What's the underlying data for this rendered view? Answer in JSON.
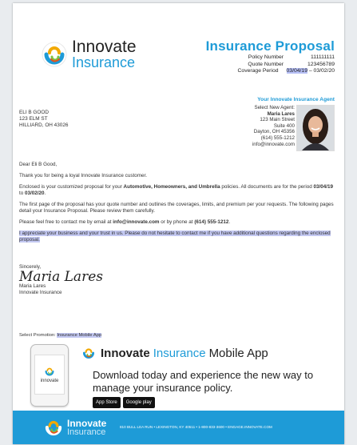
{
  "brand": {
    "word1": "Innovate",
    "word2": "Insurance"
  },
  "header": {
    "title": "Insurance Proposal",
    "policy_label": "Policy Number",
    "policy_value": "111111111",
    "quote_label": "Quote Number",
    "quote_value": "123456789",
    "coverage_label": "Coverage Period",
    "coverage_start": "03/04/19",
    "coverage_end": " – 03/02/20"
  },
  "recipient": {
    "name": "ELI B GOOD",
    "street": "123 ELM ST",
    "city": "HILLIARD, OH 43026"
  },
  "agent": {
    "heading": "Your Innovate Insurance Agent",
    "select_label": "Select New Agent:",
    "name": "Maria Lares",
    "street": "123 Main Street",
    "suite": "Suite 400",
    "city": "Dayton, OH 45356",
    "phone": "(614) 555-1212",
    "email": "info@innovate.com"
  },
  "letter": {
    "greeting": "Dear Eli B Good,",
    "p1": "Thank you for being a loyal Innovate Insurance customer.",
    "p2_a": "Enclosed is your customized proposal for your ",
    "p2_b": "Automotive, Homeowners, and Umbrella",
    "p2_c": " policies. All documents are for the period ",
    "p2_d": "03/04/19",
    "p2_e": " to ",
    "p2_f": "03/02/20",
    "p2_g": ".",
    "p3": "The first page of the proposal has your quote number and outlines the coverages, limits, and premium per your requests. The following pages detail your Insurance Proposal. Please review them carefully.",
    "p4_a": "Please feel free to contact me by email at ",
    "p4_b": "info@innovate.com",
    "p4_c": " or by phone at ",
    "p4_d": "(614) 555-1212",
    "p4_e": ".",
    "p5": "I appreciate your business and your trust in us. Please do not hesitate to contact me if you have additional questions regarding the enclosed proposal."
  },
  "signature": {
    "closing": "Sincerely,",
    "script": "Maria Lares",
    "name": "Maria Lares",
    "company": "Innovate Insurance"
  },
  "promo": {
    "label": "Select Promotion:",
    "selected": "Insurance Mobile App",
    "phone_text": "innovate",
    "title_1": "Innovate",
    "title_2": "Insurance",
    "title_3": "Mobile App",
    "desc": "Download today and experience the new way to manage your insurance policy.",
    "badge_apple": "App Store",
    "badge_google": "Google play"
  },
  "footer": {
    "word1": "Innovate",
    "word2": "Insurance",
    "address": "810 BULL LEA RUN  •  LEXINGTON, KY 40511  •  1-800-833-3600  •  ENGAGE.INNOVATE.COM"
  },
  "colors": {
    "accent": "#1e9bd7",
    "highlight": "#c3c8f2",
    "text": "#333333"
  }
}
